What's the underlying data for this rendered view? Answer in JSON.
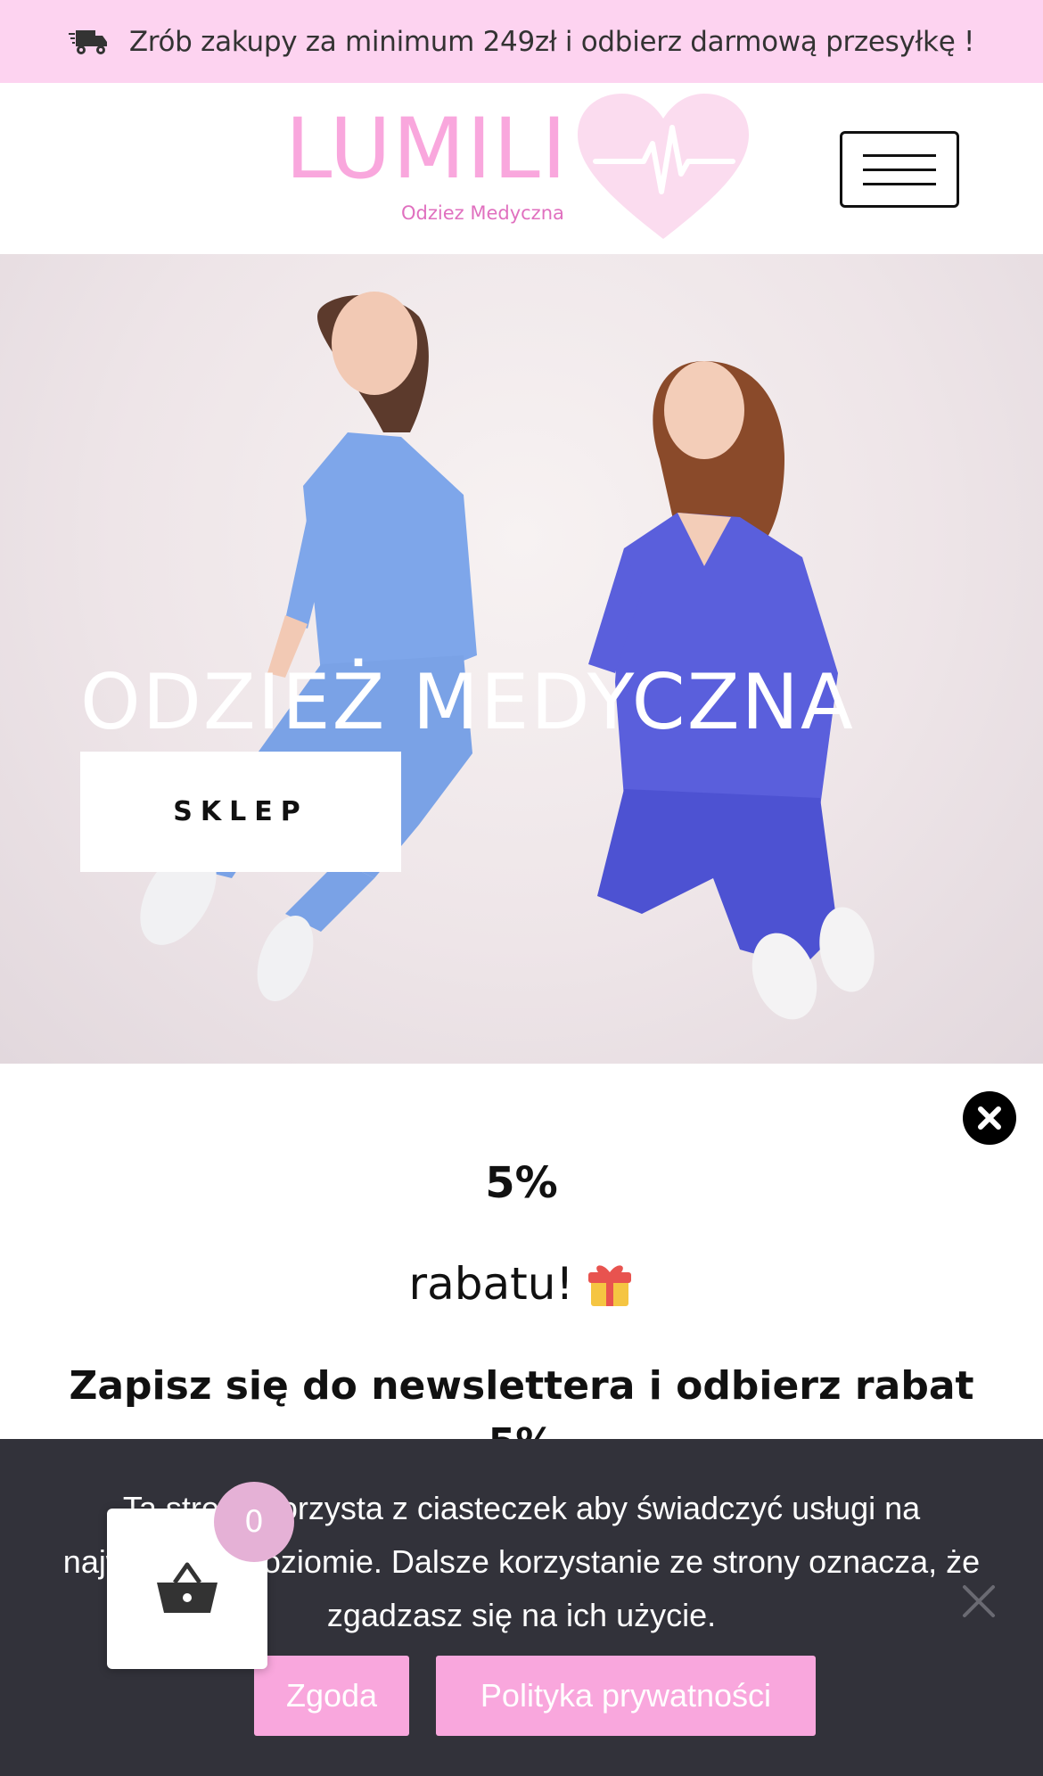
{
  "promo": {
    "text": "Zrób zakupy za minimum 249zł i odbierz darmową przesyłkę !",
    "icon": "delivery-truck-icon"
  },
  "header": {
    "logo_word": "LUMILI",
    "logo_sub": "Odziez Medyczna",
    "logo_icon": "heart-pulse-icon",
    "menu_icon": "hamburger-menu-icon"
  },
  "hero": {
    "title": "ODZIEŻ MEDYCZNA",
    "button_label": "SKLEP"
  },
  "newsletter": {
    "discount": "5%",
    "rabatu": "rabatu!",
    "gift_icon": "gift-icon",
    "subscribe_text": "Zapisz się do newslettera i odbierz rabat 5%"
  },
  "cookie": {
    "text": "Ta strona korzysta z ciasteczek aby świadczyć usługi na najwyższym poziomie. Dalsze korzystanie ze strony oznacza, że zgadzasz się na ich użycie.",
    "agree_label": "Zgoda",
    "policy_label": "Polityka prywatności"
  },
  "cart": {
    "count": "0",
    "icon": "basket-icon"
  },
  "colors": {
    "promo_bg": "#fdd3f0",
    "brand_pink": "#f9a7dd",
    "cookie_bg": "#32323a",
    "cart_badge": "#e5b1d6"
  }
}
